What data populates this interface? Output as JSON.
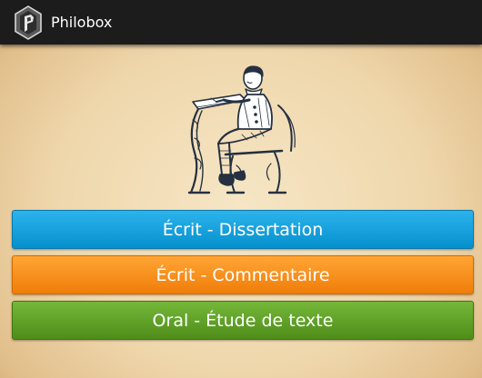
{
  "app": {
    "title": "Philobox",
    "icon": "philobox-logo-icon"
  },
  "illustration": {
    "name": "boy-writing-at-school-desk"
  },
  "buttons": [
    {
      "label": "Écrit - Dissertation",
      "color": "#0a9ad9"
    },
    {
      "label": "Écrit - Commentaire",
      "color": "#f7890f"
    },
    {
      "label": "Oral - Étude de texte",
      "color": "#5fa126"
    }
  ],
  "colors": {
    "action_bar": "#1c1c1c",
    "background": "#efd7ac"
  }
}
